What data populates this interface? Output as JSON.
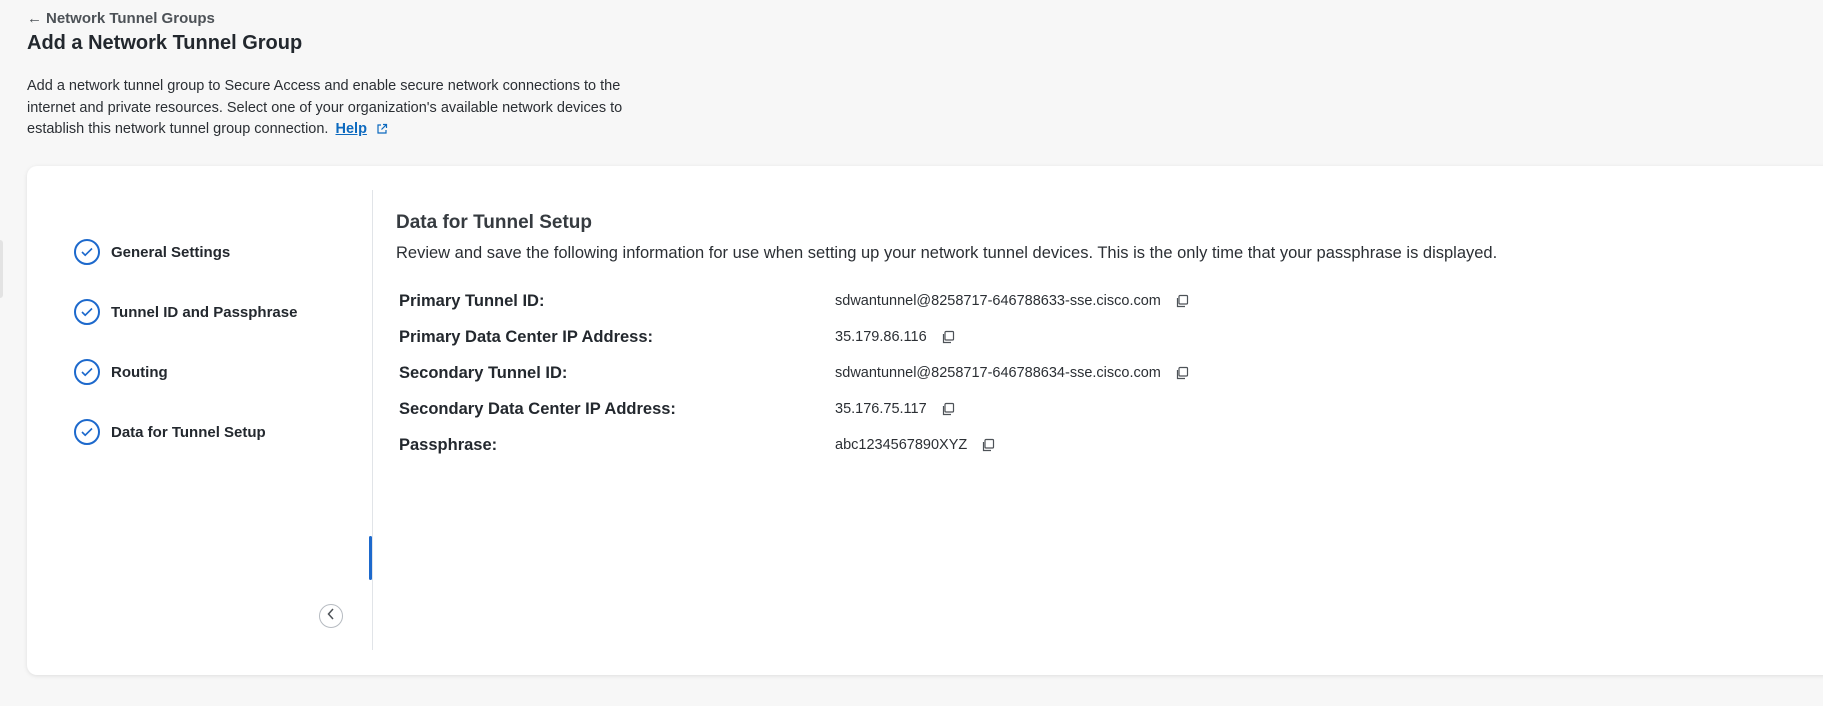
{
  "breadcrumb": {
    "label": "Network Tunnel Groups"
  },
  "page": {
    "title": "Add a Network Tunnel Group",
    "description": "Add a network tunnel group to Secure Access and enable secure network connections to the internet and private resources. Select one of your organization's available network devices to establish this network tunnel group connection.",
    "help_label": "Help"
  },
  "steps": [
    {
      "label": "General Settings",
      "status": "complete"
    },
    {
      "label": "Tunnel ID and Passphrase",
      "status": "complete"
    },
    {
      "label": "Routing",
      "status": "complete"
    },
    {
      "label": "Data for Tunnel Setup",
      "status": "complete",
      "active": true
    }
  ],
  "setup": {
    "title": "Data for Tunnel Setup",
    "description": "Review and save the following information for use when setting up your network tunnel devices. This is the only time that your passphrase is displayed.",
    "rows": [
      {
        "label": "Primary Tunnel ID:",
        "value": "sdwantunnel@8258717-646788633-sse.cisco.com"
      },
      {
        "label": "Primary Data Center IP Address:",
        "value": "35.179.86.116"
      },
      {
        "label": "Secondary Tunnel ID:",
        "value": "sdwantunnel@8258717-646788634-sse.cisco.com"
      },
      {
        "label": "Secondary Data Center IP Address:",
        "value": "35.176.75.117"
      },
      {
        "label": "Passphrase:",
        "value": "abc1234567890XYZ"
      }
    ]
  },
  "icons": {
    "back": "arrow-left-icon",
    "external": "external-link-icon",
    "check": "check-icon",
    "copy": "copy-icon",
    "collapse": "chevron-left-icon"
  },
  "colors": {
    "accent": "#1d69cc",
    "link": "#0d6abf",
    "background": "#f7f7f7",
    "card": "#ffffff"
  }
}
